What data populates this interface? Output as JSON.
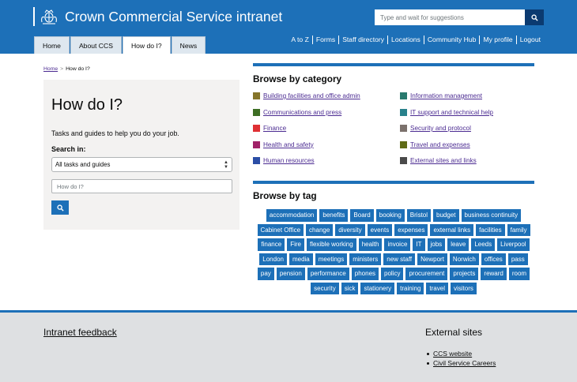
{
  "header": {
    "site_title": "Crown Commercial Service intranet",
    "search_placeholder": "Type and wait for suggestions",
    "search_icon": "search-icon",
    "crest_icon": "royal-crest-icon",
    "tabs": [
      {
        "label": "Home",
        "active": false
      },
      {
        "label": "About CCS",
        "active": false
      },
      {
        "label": "How do I?",
        "active": true
      },
      {
        "label": "News",
        "active": false
      }
    ],
    "links": [
      "A to Z",
      "Forms",
      "Staff directory",
      "Locations",
      "Community Hub",
      "My profile",
      "Logout"
    ]
  },
  "breadcrumb": {
    "home": "Home",
    "separator": ">",
    "current": "How do I?"
  },
  "panel": {
    "title": "How do I?",
    "description": "Tasks and guides to help you do your job.",
    "search_in_label": "Search in:",
    "select_value": "All tasks and guides",
    "input_placeholder": "How do I?",
    "search_icon": "search-icon"
  },
  "browse_category": {
    "title": "Browse by category",
    "items": [
      {
        "label": "Building facilities and office admin",
        "color": "#85752a"
      },
      {
        "label": "Information management",
        "color": "#28796d"
      },
      {
        "label": "Communications and press",
        "color": "#3d6e24"
      },
      {
        "label": "IT support and technical help",
        "color": "#28818b"
      },
      {
        "label": "Finance",
        "color": "#df3034"
      },
      {
        "label": "Security and protocol",
        "color": "#7b716c"
      },
      {
        "label": "Health and safety",
        "color": "#a02268"
      },
      {
        "label": "Travel and expenses",
        "color": "#5e6b16"
      },
      {
        "label": "Human resources",
        "color": "#2b4ea6"
      },
      {
        "label": "External sites and links",
        "color": "#4a4a4a"
      }
    ]
  },
  "browse_tag": {
    "title": "Browse by tag",
    "tags": [
      "accommodation",
      "benefits",
      "Board",
      "booking",
      "Bristol",
      "budget",
      "business continuity",
      "Cabinet Office",
      "change",
      "diversity",
      "events",
      "expenses",
      "external links",
      "facilities",
      "family",
      "finance",
      "Fire",
      "flexible working",
      "health",
      "invoice",
      "IT",
      "jobs",
      "leave",
      "Leeds",
      "Liverpool",
      "London",
      "media",
      "meetings",
      "ministers",
      "new staff",
      "Newport",
      "Norwich",
      "offices",
      "pass",
      "pay",
      "pension",
      "performance",
      "phones",
      "policy",
      "procurement",
      "projects",
      "reward",
      "room",
      "security",
      "sick",
      "stationery",
      "training",
      "travel",
      "visitors"
    ]
  },
  "footer": {
    "feedback": "Intranet feedback",
    "external_title": "External sites",
    "external_links": [
      "CCS website",
      "Civil Service Careers"
    ]
  },
  "colors": {
    "brand_blue": "#1d70b8",
    "link_purple": "#4c2c92",
    "panel_grey": "#f3f2f1",
    "footer_grey": "#dee0e2"
  }
}
